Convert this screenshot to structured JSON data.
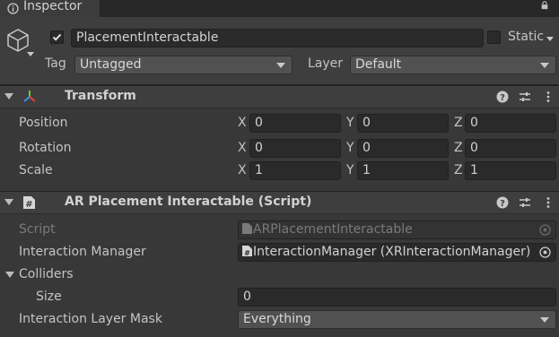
{
  "tab": {
    "title": "Inspector"
  },
  "header": {
    "object_name": "PlacementInteractable",
    "static_label": "Static",
    "tag_label": "Tag",
    "tag_value": "Untagged",
    "layer_label": "Layer",
    "layer_value": "Default"
  },
  "transform": {
    "title": "Transform",
    "rows": [
      {
        "label": "Position",
        "x": "0",
        "y": "0",
        "z": "0"
      },
      {
        "label": "Rotation",
        "x": "0",
        "y": "0",
        "z": "0"
      },
      {
        "label": "Scale",
        "x": "1",
        "y": "1",
        "z": "1"
      }
    ],
    "axes": {
      "x": "X",
      "y": "Y",
      "z": "Z"
    }
  },
  "script_component": {
    "title": "AR Placement Interactable (Script)",
    "script_label": "Script",
    "script_value": "ARPlacementInteractable",
    "manager_label": "Interaction Manager",
    "manager_value": "InteractionManager (XRInteractionManager)",
    "colliders_label": "Colliders",
    "size_label": "Size",
    "size_value": "0",
    "layer_mask_label": "Interaction Layer Mask",
    "layer_mask_value": "Everything"
  },
  "colors": {
    "background": "#383838",
    "header": "#3e3e3e",
    "field": "#2a2a2a",
    "tabbar": "#282828"
  }
}
